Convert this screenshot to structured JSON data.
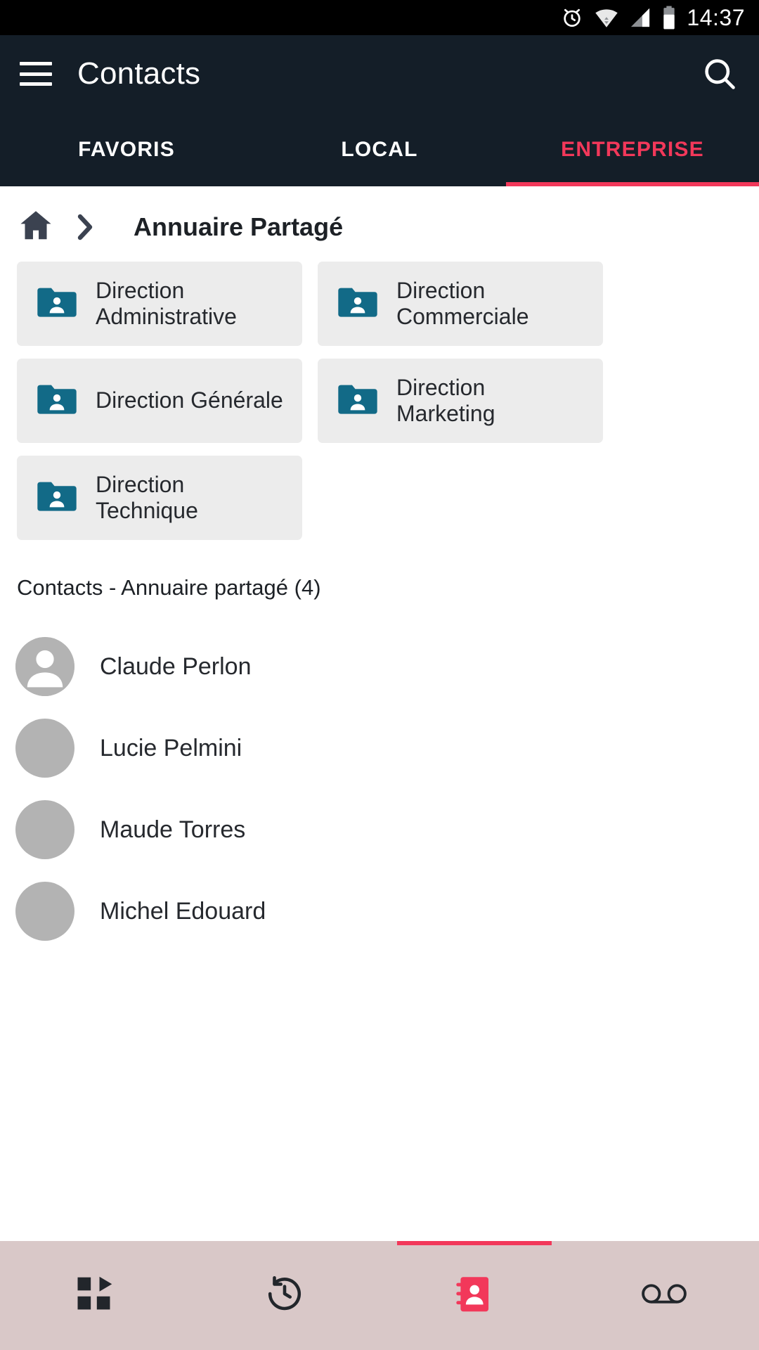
{
  "statusbar": {
    "time": "14:37",
    "icons": [
      "alarm-icon",
      "wifi-icon",
      "signal-icon",
      "battery-icon"
    ]
  },
  "appbar": {
    "menu_icon": "hamburger-menu-icon",
    "title": "Contacts",
    "search_icon": "search-icon"
  },
  "tabs": [
    {
      "label": "FAVORIS",
      "active": false
    },
    {
      "label": "LOCAL",
      "active": false
    },
    {
      "label": "ENTREPRISE",
      "active": true
    }
  ],
  "breadcrumb": {
    "home_icon": "home-icon",
    "separator_icon": "chevron-right-icon",
    "label": "Annuaire Partagé"
  },
  "folders": [
    {
      "label": "Direction Administrative",
      "icon": "folder-shared-icon"
    },
    {
      "label": "Direction Commerciale",
      "icon": "folder-shared-icon"
    },
    {
      "label": "Direction Générale",
      "icon": "folder-shared-icon"
    },
    {
      "label": "Direction Marketing",
      "icon": "folder-shared-icon"
    },
    {
      "label": "Direction Technique",
      "icon": "folder-shared-icon"
    }
  ],
  "contacts_section": {
    "title": "Contacts - Annuaire partagé (4)",
    "items": [
      {
        "name": "Claude Perlon",
        "avatar": "placeholder-person-icon"
      },
      {
        "name": "Lucie Pelmini",
        "avatar": "photo"
      },
      {
        "name": "Maude Torres",
        "avatar": "photo"
      },
      {
        "name": "Michel Edouard",
        "avatar": "photo"
      }
    ]
  },
  "bottomnav": [
    {
      "icon": "apps-grid-icon",
      "active": false
    },
    {
      "icon": "call-history-icon",
      "active": false
    },
    {
      "icon": "contacts-icon",
      "active": true
    },
    {
      "icon": "voicemail-icon",
      "active": false
    }
  ],
  "colors": {
    "accent": "#f2385a",
    "appbar": "#141e28",
    "folder_icon": "#126a87",
    "card_bg": "#ececec",
    "bottomnav_bg": "#d9c8c8"
  }
}
